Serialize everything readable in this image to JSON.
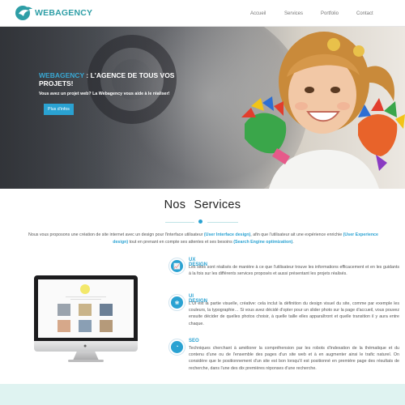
{
  "brand": {
    "name": "WEBAGENCY",
    "color": "#2e9ea6"
  },
  "nav": {
    "items": [
      {
        "label": "Accueil"
      },
      {
        "label": "Services"
      },
      {
        "label": "Portfolio"
      },
      {
        "label": "Contact"
      }
    ]
  },
  "hero": {
    "title_accent": "WEBAGENCY",
    "title_rest": " : L'AGENCE DE TOUS VOS PROJETS!",
    "subtitle": "Vous avez un projet web? La Webagency vous aide à le réaliser!",
    "button_label": "Plus d'infos"
  },
  "services": {
    "title_word1": "Nos",
    "title_word2": "Services",
    "intro_1": "Nous vous proposons une création de site internet avec un design pour l'interface utilisateur ",
    "intro_hl1": "(User Interface design)",
    "intro_2": ", afin que l'utilisateur ait une expérience enrichie ",
    "intro_hl2": "(User Experience design)",
    "intro_3": " tout en prenant en compte ses attentes et ses besoins ",
    "intro_hl3": "(Search Engine optimization)",
    "intro_4": ".",
    "items": [
      {
        "icon": "chart-icon",
        "title": "UX DESIGN",
        "text": "Les sites sont réalisés de manière à ce que l'utilisateur trouve les informations efficacement et en les guidants à la fois sur les différents services proposés et aussi présentant les projets réalisés."
      },
      {
        "icon": "palette-icon",
        "title": "UI DESIGN",
        "text": "L'UI est la partie visuelle, créative: cela inclut la définition du design visuel du site, comme par exemple les couleurs, la typographie… Si vous avez décidé d'opter pour un slider photo sur la page d'accueil, vous pouvez ensuite décider de quelles photos choisir, à quelle taille elles apparaîtront et quelle transition il y aura entre chaque."
      },
      {
        "icon": "pie-chart-icon",
        "title": "SEO",
        "text": "Techniques cherchant à améliorer la compréhension par les robots d'indexation de la thématique et du contenu d'une ou de l'ensemble des pages d'un site web et à en augmenter ainsi le trafic naturel. On considère que le positionnement d'un site est bon lorsqu'il est positionné en première page des résultats de recherche, dans l'une des dix premières réponses d'une recherche."
      }
    ]
  },
  "colors": {
    "accent": "#2aa2d2",
    "footer": "#dff3f1"
  }
}
